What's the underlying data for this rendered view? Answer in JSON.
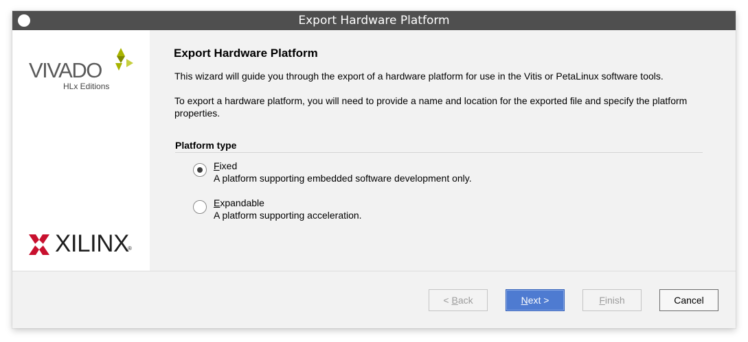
{
  "window": {
    "title": "Export Hardware Platform"
  },
  "branding": {
    "vivado": "VIVADO",
    "edition": "HLx Editions",
    "vendor": "XILINX",
    "registered": "®",
    "accent_color": "#a8b400",
    "vendor_color": "#c8102e"
  },
  "wizard": {
    "heading": "Export Hardware Platform",
    "intro": "This wizard will guide you through the export of a hardware platform for use in the Vitis or PetaLinux software tools.",
    "instructions": "To export a hardware platform, you will need to provide a name and location for the exported file and specify the platform properties."
  },
  "platform_type": {
    "section_label": "Platform type",
    "selected": "Fixed",
    "options": [
      {
        "mnemonic": "F",
        "rest": "ixed",
        "description": "A platform supporting embedded software development only.",
        "checked": true
      },
      {
        "mnemonic": "E",
        "rest": "xpandable",
        "description": "A platform supporting acceleration.",
        "checked": false
      }
    ]
  },
  "buttons": {
    "back": {
      "prefix": "< ",
      "mnemonic": "B",
      "rest": "ack",
      "enabled": false
    },
    "next": {
      "mnemonic": "N",
      "rest": "ext >",
      "enabled": true
    },
    "finish": {
      "mnemonic": "F",
      "rest": "inish",
      "enabled": false
    },
    "cancel": {
      "label": "Cancel",
      "enabled": true
    }
  }
}
